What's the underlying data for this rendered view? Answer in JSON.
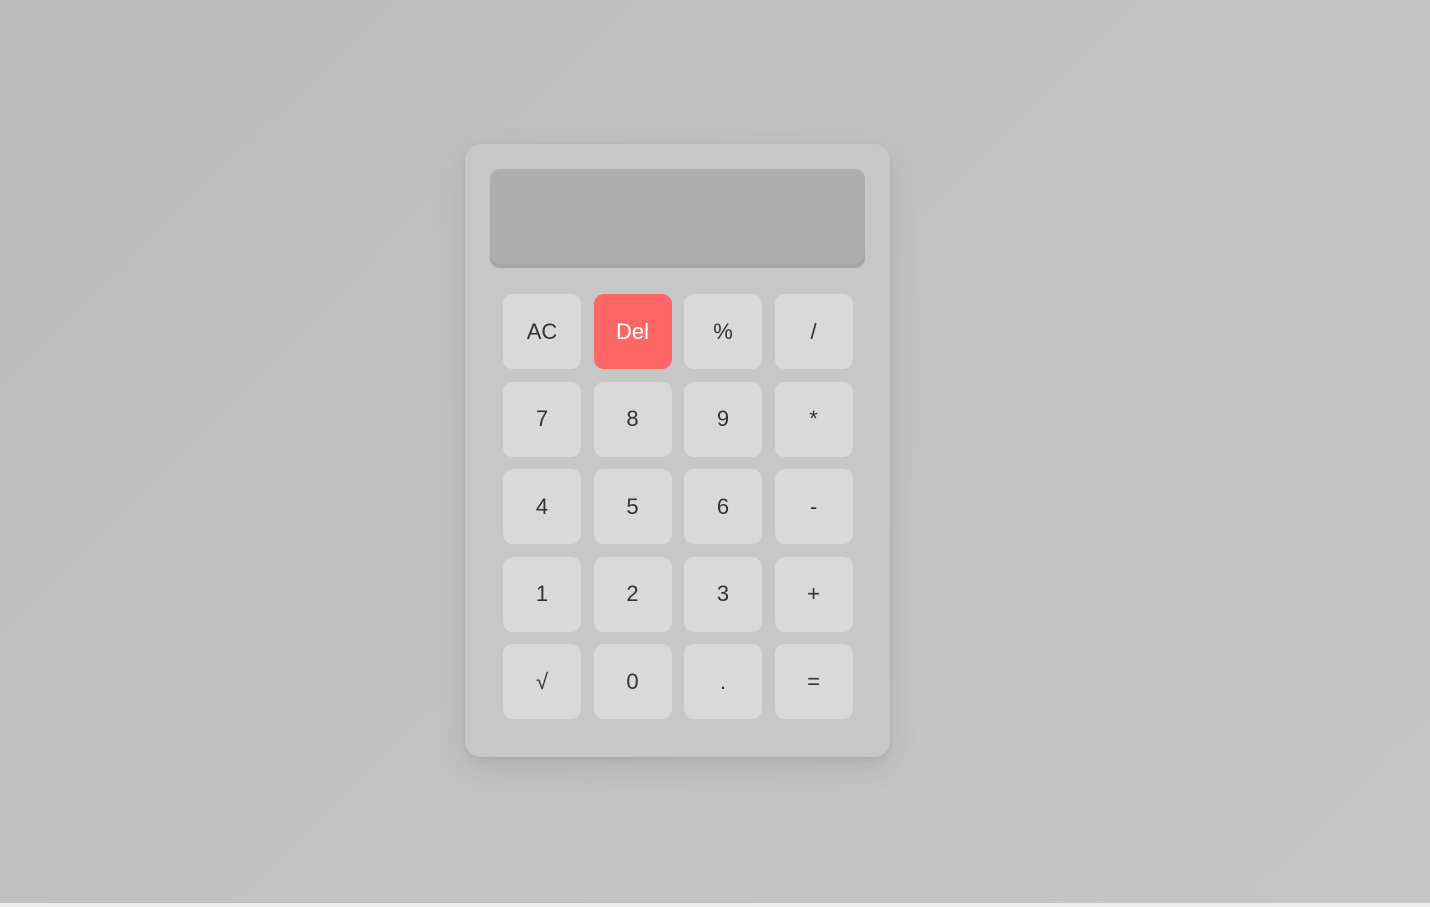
{
  "display": {
    "value": ""
  },
  "keys": {
    "ac": "AC",
    "del": "Del",
    "percent": "%",
    "divide": "/",
    "seven": "7",
    "eight": "8",
    "nine": "9",
    "multiply": "*",
    "four": "4",
    "five": "5",
    "six": "6",
    "subtract": "-",
    "one": "1",
    "two": "2",
    "three": "3",
    "add": "+",
    "sqrt": "√",
    "zero": "0",
    "decimal": ".",
    "equals": "="
  },
  "colors": {
    "background": "#c2c2c2",
    "body": "#c7c7c7",
    "display": "#aeaeae",
    "key": "#d9d9d9",
    "delete_key": "#ff6666",
    "key_text": "#333333"
  }
}
